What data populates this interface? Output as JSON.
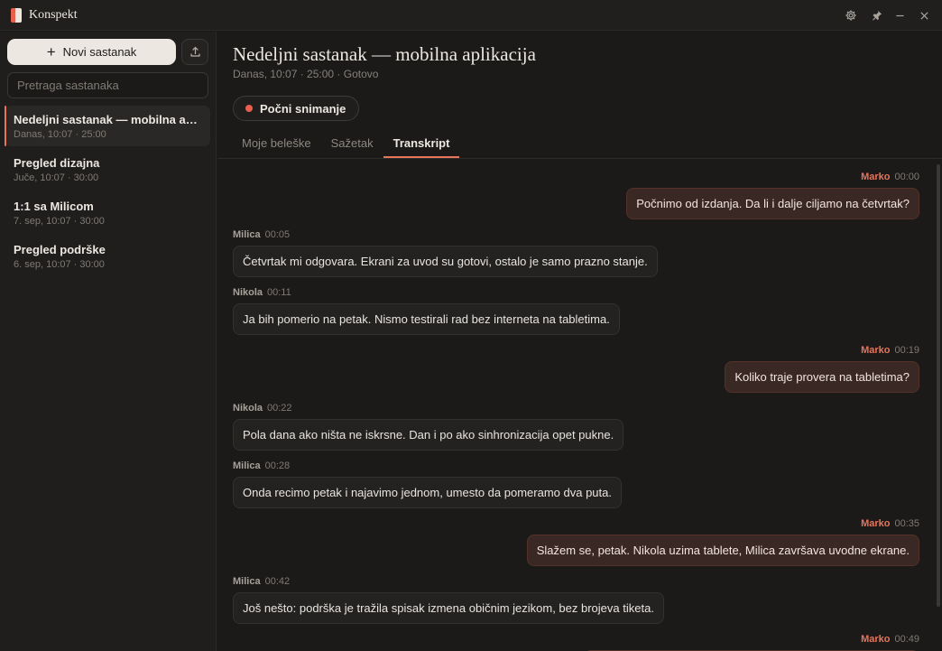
{
  "app": {
    "name": "Konspekt"
  },
  "sidebar": {
    "new_button_label": "Novi sastanak",
    "search_placeholder": "Pretraga sastanaka",
    "meetings": [
      {
        "title": "Nedeljni sastanak — mobilna aplikacija",
        "meta": "Danas, 10:07 · 25:00"
      },
      {
        "title": "Pregled dizajna",
        "meta": "Juče, 10:07 · 30:00"
      },
      {
        "title": "1:1 sa Milicom",
        "meta": "7. sep, 10:07 · 30:00"
      },
      {
        "title": "Pregled podrške",
        "meta": "6. sep, 10:07 · 30:00"
      }
    ]
  },
  "main": {
    "title": "Nedeljni sastanak — mobilna aplikacija",
    "meta": "Danas, 10:07 · 25:00 · Gotovo",
    "record_label": "Počni snimanje",
    "tabs": [
      {
        "label": "Moje beleške"
      },
      {
        "label": "Sažetak"
      },
      {
        "label": "Transkript"
      }
    ]
  },
  "transcript": [
    {
      "speaker": "Marko",
      "time": "00:00",
      "text": "Počnimo od izdanja. Da li i dalje ciljamo na četvrtak?"
    },
    {
      "speaker": "Milica",
      "time": "00:05",
      "text": "Četvrtak mi odgovara. Ekrani za uvod su gotovi, ostalo je samo prazno stanje."
    },
    {
      "speaker": "Nikola",
      "time": "00:11",
      "text": "Ja bih pomerio na petak. Nismo testirali rad bez interneta na tabletima."
    },
    {
      "speaker": "Marko",
      "time": "00:19",
      "text": "Koliko traje provera na tabletima?"
    },
    {
      "speaker": "Nikola",
      "time": "00:22",
      "text": "Pola dana ako ništa ne iskrsne. Dan i po ako sinhronizacija opet pukne."
    },
    {
      "speaker": "Milica",
      "time": "00:28",
      "text": "Onda recimo petak i najavimo jednom, umesto da pomeramo dva puta."
    },
    {
      "speaker": "Marko",
      "time": "00:35",
      "text": "Slažem se, petak. Nikola uzima tablete, Milica završava uvodne ekrane."
    },
    {
      "speaker": "Milica",
      "time": "00:42",
      "text": "Još nešto: podrška je tražila spisak izmena običnim jezikom, bez brojeva tiketa."
    },
    {
      "speaker": "Marko",
      "time": "00:49",
      "text": ""
    }
  ],
  "icons": {
    "window": [
      "gear-icon",
      "pin-icon",
      "minimize-icon",
      "close-icon"
    ],
    "export": "upload-icon"
  },
  "colors": {
    "accent": "#e8745a",
    "record": "#e8604c"
  }
}
